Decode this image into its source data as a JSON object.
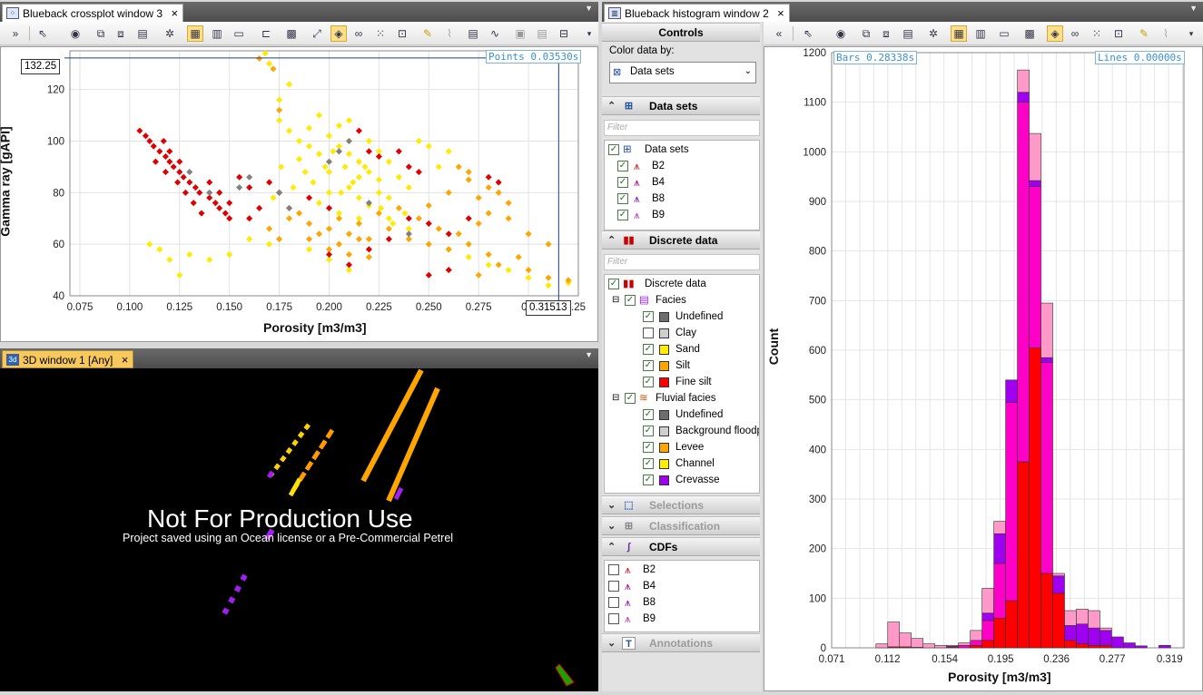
{
  "crossplot": {
    "tab_title": "Blueback crossplot window 3",
    "points_readout": "Points 0.03530s",
    "cursor_y": "132.25",
    "cursor_x": "0.31513",
    "xlabel": "Porosity [m3/m3]",
    "ylabel": "Gamma ray [gAPI]",
    "xticks": [
      "0.075",
      "0.100",
      "0.125",
      "0.150",
      "0.175",
      "0.200",
      "0.225",
      "0.250",
      "0.275",
      "0.3",
      ".25"
    ],
    "yticks": [
      "120",
      "100",
      "80",
      "60",
      "40"
    ],
    "colors": {
      "sand": "#ffea00",
      "silt": "#ffa500",
      "fine_silt": "#e00000",
      "undefined": "#808080"
    }
  },
  "window3d": {
    "tab_title": "3D window 1 [Any]",
    "watermark_title": "Not For Production Use",
    "watermark_sub": "Project saved using an Ocean license or a Pre-Commercial Petrel"
  },
  "controls": {
    "title": "Controls",
    "color_by_label": "Color data by:",
    "color_by_value": "Data sets",
    "sections": {
      "data_sets": "Data sets",
      "discrete_data": "Discrete data",
      "selections": "Selections",
      "classification_groups": "Classification groups",
      "cdfs": "CDFs",
      "annotations": "Annotations"
    },
    "filter_placeholder": "Filter",
    "datasets_root": "Data sets",
    "datasets": [
      "B2",
      "B4",
      "B8",
      "B9"
    ],
    "discrete_root": "Discrete data",
    "facies_label": "Facies",
    "facies": [
      {
        "name": "Undefined",
        "color": "#6e6e6e",
        "checked": true
      },
      {
        "name": "Clay",
        "color": "#cfcfcf",
        "checked": false
      },
      {
        "name": "Sand",
        "color": "#ffee00",
        "checked": true
      },
      {
        "name": "Silt",
        "color": "#ffa500",
        "checked": true
      },
      {
        "name": "Fine silt",
        "color": "#ff0000",
        "checked": true
      }
    ],
    "fluvial_label": "Fluvial facies",
    "fluvial": [
      {
        "name": "Undefined",
        "color": "#6e6e6e",
        "checked": true
      },
      {
        "name": "Background floodp",
        "color": "#cfcfcf",
        "checked": true
      },
      {
        "name": "Levee",
        "color": "#ffa500",
        "checked": true
      },
      {
        "name": "Channel",
        "color": "#ffee00",
        "checked": true
      },
      {
        "name": "Crevasse",
        "color": "#a000f0",
        "checked": true
      }
    ],
    "cdfs": [
      "B2",
      "B4",
      "B8",
      "B9"
    ]
  },
  "histogram": {
    "tab_title": "Blueback histogram window 2",
    "bars_readout": "Bars 0.28338s",
    "lines_readout": "Lines 0.00000s"
  },
  "chart_data": [
    {
      "type": "scatter",
      "title": "",
      "xlabel": "Porosity [m3/m3]",
      "ylabel": "Gamma ray [gAPI]",
      "xlim": [
        0.07,
        0.325
      ],
      "ylim": [
        40,
        135
      ],
      "grid": true,
      "series": [
        {
          "name": "Sand",
          "color": "#ffea00",
          "points": [
            [
              0.19,
              105
            ],
            [
              0.195,
              110
            ],
            [
              0.2,
              102
            ],
            [
              0.205,
              98
            ],
            [
              0.21,
              95
            ],
            [
              0.215,
              92
            ],
            [
              0.22,
              88
            ],
            [
              0.225,
              85
            ],
            [
              0.2,
              92
            ],
            [
              0.19,
              98
            ],
            [
              0.185,
              100
            ],
            [
              0.21,
              100
            ],
            [
              0.2,
              88
            ],
            [
              0.21,
              82
            ],
            [
              0.215,
              78
            ],
            [
              0.22,
              75
            ],
            [
              0.225,
              80
            ],
            [
              0.23,
              78
            ],
            [
              0.195,
              95
            ],
            [
              0.205,
              106
            ],
            [
              0.21,
              108
            ],
            [
              0.22,
              100
            ],
            [
              0.225,
              96
            ],
            [
              0.23,
              92
            ],
            [
              0.235,
              86
            ],
            [
              0.24,
              82
            ],
            [
              0.18,
              104
            ],
            [
              0.175,
              108
            ],
            [
              0.185,
              93
            ],
            [
              0.2,
              80
            ],
            [
              0.195,
              76
            ],
            [
              0.205,
              72
            ],
            [
              0.215,
              70
            ],
            [
              0.23,
              70
            ],
            [
              0.24,
              66
            ],
            [
              0.17,
              130
            ],
            [
              0.168,
              134
            ],
            [
              0.18,
              122
            ],
            [
              0.175,
              116
            ],
            [
              0.245,
              100
            ],
            [
              0.25,
              98
            ],
            [
              0.26,
              96
            ],
            [
              0.255,
              90
            ],
            [
              0.17,
              60
            ],
            [
              0.16,
              62
            ],
            [
              0.15,
              56
            ],
            [
              0.14,
              54
            ],
            [
              0.13,
              56
            ],
            [
              0.12,
              54
            ],
            [
              0.115,
              58
            ],
            [
              0.125,
              48
            ],
            [
              0.11,
              60
            ],
            [
              0.19,
              58
            ],
            [
              0.2,
              54
            ],
            [
              0.21,
              50
            ],
            [
              0.26,
              58
            ],
            [
              0.27,
              55
            ],
            [
              0.28,
              52
            ],
            [
              0.29,
              50
            ],
            [
              0.3,
              47
            ],
            [
              0.31,
              44
            ],
            [
              0.32,
              45
            ],
            [
              0.215,
              86
            ],
            [
              0.218,
              90
            ],
            [
              0.212,
              84
            ],
            [
              0.208,
              90
            ],
            [
              0.202,
              96
            ],
            [
              0.198,
              90
            ],
            [
              0.192,
              84
            ],
            [
              0.188,
              88
            ],
            [
              0.206,
              80
            ],
            [
              0.226,
              74
            ],
            [
              0.232,
              68
            ],
            [
              0.238,
              72
            ],
            [
              0.176,
              90
            ],
            [
              0.182,
              82
            ],
            [
              0.172,
              78
            ]
          ]
        },
        {
          "name": "Silt",
          "color": "#ffa500",
          "points": [
            [
              0.23,
              66
            ],
            [
              0.24,
              62
            ],
            [
              0.25,
              60
            ],
            [
              0.26,
              58
            ],
            [
              0.27,
              60
            ],
            [
              0.28,
              56
            ],
            [
              0.22,
              62
            ],
            [
              0.21,
              64
            ],
            [
              0.2,
              66
            ],
            [
              0.19,
              68
            ],
            [
              0.18,
              70
            ],
            [
              0.17,
              66
            ],
            [
              0.175,
              62
            ],
            [
              0.19,
              62
            ],
            [
              0.2,
              58
            ],
            [
              0.21,
              56
            ],
            [
              0.22,
              55
            ],
            [
              0.25,
              75
            ],
            [
              0.26,
              80
            ],
            [
              0.27,
              85
            ],
            [
              0.28,
              82
            ],
            [
              0.275,
              78
            ],
            [
              0.285,
              80
            ],
            [
              0.29,
              76
            ],
            [
              0.265,
              90
            ],
            [
              0.27,
              88
            ],
            [
              0.28,
              72
            ],
            [
              0.29,
              70
            ],
            [
              0.3,
              64
            ],
            [
              0.31,
              60
            ],
            [
              0.295,
              55
            ],
            [
              0.285,
              52
            ],
            [
              0.275,
              48
            ],
            [
              0.3,
              50
            ],
            [
              0.31,
              47
            ],
            [
              0.32,
              46
            ],
            [
              0.205,
              70
            ],
            [
              0.215,
              68
            ],
            [
              0.225,
              72
            ],
            [
              0.235,
              74
            ],
            [
              0.245,
              70
            ],
            [
              0.255,
              66
            ],
            [
              0.265,
              64
            ],
            [
              0.275,
              68
            ],
            [
              0.175,
              112
            ],
            [
              0.172,
              128
            ],
            [
              0.165,
              132
            ],
            [
              0.18,
              74
            ],
            [
              0.185,
              72
            ],
            [
              0.195,
              64
            ],
            [
              0.205,
              60
            ],
            [
              0.215,
              62
            ]
          ]
        },
        {
          "name": "Fine silt",
          "color": "#e00000",
          "points": [
            [
              0.105,
              104
            ],
            [
              0.108,
              102
            ],
            [
              0.11,
              100
            ],
            [
              0.112,
              98
            ],
            [
              0.115,
              96
            ],
            [
              0.118,
              94
            ],
            [
              0.12,
              92
            ],
            [
              0.122,
              90
            ],
            [
              0.125,
              88
            ],
            [
              0.127,
              86
            ],
            [
              0.13,
              84
            ],
            [
              0.133,
              82
            ],
            [
              0.135,
              80
            ],
            [
              0.14,
              78
            ],
            [
              0.143,
              76
            ],
            [
              0.145,
              74
            ],
            [
              0.148,
              72
            ],
            [
              0.15,
              70
            ],
            [
              0.113,
              92
            ],
            [
              0.118,
              88
            ],
            [
              0.124,
              84
            ],
            [
              0.128,
              80
            ],
            [
              0.132,
              76
            ],
            [
              0.136,
              72
            ],
            [
              0.12,
              96
            ],
            [
              0.117,
              100
            ],
            [
              0.125,
              92
            ],
            [
              0.14,
              84
            ],
            [
              0.145,
              80
            ],
            [
              0.15,
              76
            ],
            [
              0.155,
              86
            ],
            [
              0.16,
              82
            ],
            [
              0.17,
              84
            ],
            [
              0.175,
              80
            ],
            [
              0.2,
              56
            ],
            [
              0.21,
              52
            ],
            [
              0.22,
              58
            ],
            [
              0.23,
              62
            ],
            [
              0.24,
              70
            ],
            [
              0.25,
              68
            ],
            [
              0.26,
              64
            ],
            [
              0.27,
              70
            ],
            [
              0.28,
              86
            ],
            [
              0.285,
              84
            ],
            [
              0.19,
              78
            ],
            [
              0.2,
              74
            ],
            [
              0.215,
              104
            ],
            [
              0.22,
              96
            ],
            [
              0.225,
              94
            ],
            [
              0.235,
              96
            ],
            [
              0.24,
              90
            ],
            [
              0.245,
              88
            ],
            [
              0.25,
              48
            ],
            [
              0.26,
              50
            ],
            [
              0.165,
              74
            ],
            [
              0.16,
              70
            ]
          ]
        },
        {
          "name": "Undefined",
          "color": "#808080",
          "points": [
            [
              0.21,
              100
            ],
            [
              0.205,
              96
            ],
            [
              0.16,
              86
            ],
            [
              0.155,
              82
            ],
            [
              0.175,
              80
            ],
            [
              0.18,
              74
            ],
            [
              0.24,
              64
            ],
            [
              0.22,
              76
            ],
            [
              0.2,
              92
            ],
            [
              0.13,
              88
            ],
            [
              0.14,
              80
            ]
          ]
        }
      ]
    },
    {
      "type": "bar",
      "title": "",
      "xlabel": "Porosity [m3/m3]",
      "ylabel": "Count",
      "xlim": [
        0.071,
        0.3295
      ],
      "ylim": [
        0,
        1200
      ],
      "grid": true,
      "xticks": [
        "0.071",
        "0.112",
        "0.154",
        "0.195",
        "0.236",
        "0.277",
        "0.319"
      ],
      "yticks": [
        "0",
        "100",
        "200",
        "300",
        "400",
        "500",
        "600",
        "700",
        "800",
        "900",
        "1000",
        "1100",
        "1200"
      ],
      "bin_width": 0.00865,
      "bin_starts": [
        0.1035,
        0.11215,
        0.1208,
        0.12945,
        0.1381,
        0.14675,
        0.1554,
        0.16405,
        0.1727,
        0.18135,
        0.19,
        0.19865,
        0.2073,
        0.21595,
        0.2246,
        0.23325,
        0.2419,
        0.25055,
        0.2592,
        0.26785,
        0.2765,
        0.28515,
        0.2938,
        0.30245,
        0.3111,
        0.31975
      ],
      "series": [
        {
          "name": "Fine silt",
          "color": "#ff0000",
          "values": [
            0,
            2,
            2,
            1,
            0,
            0,
            1,
            0,
            5,
            15,
            60,
            95,
            375,
            605,
            150,
            110,
            15,
            8,
            5,
            5,
            0,
            0,
            0,
            0,
            0,
            0
          ]
        },
        {
          "name": "Channel",
          "color": "#ff00c8",
          "values": [
            0,
            0,
            0,
            0,
            0,
            0,
            2,
            5,
            10,
            40,
            110,
            400,
            725,
            325,
            425,
            0,
            0,
            0,
            0,
            0,
            0,
            0,
            0,
            0,
            0,
            0
          ]
        },
        {
          "name": "Crevasse",
          "color": "#a000f0",
          "values": [
            0,
            0,
            0,
            0,
            0,
            0,
            0,
            0,
            0,
            15,
            60,
            45,
            20,
            12,
            10,
            35,
            30,
            40,
            35,
            30,
            22,
            10,
            4,
            0,
            5,
            0
          ]
        },
        {
          "name": "Background",
          "color": "#ff99c8",
          "values": [
            8,
            50,
            28,
            18,
            8,
            5,
            2,
            5,
            20,
            50,
            25,
            0,
            45,
            95,
            110,
            5,
            30,
            30,
            35,
            5,
            0,
            0,
            0,
            0,
            0,
            0
          ]
        }
      ]
    }
  ]
}
